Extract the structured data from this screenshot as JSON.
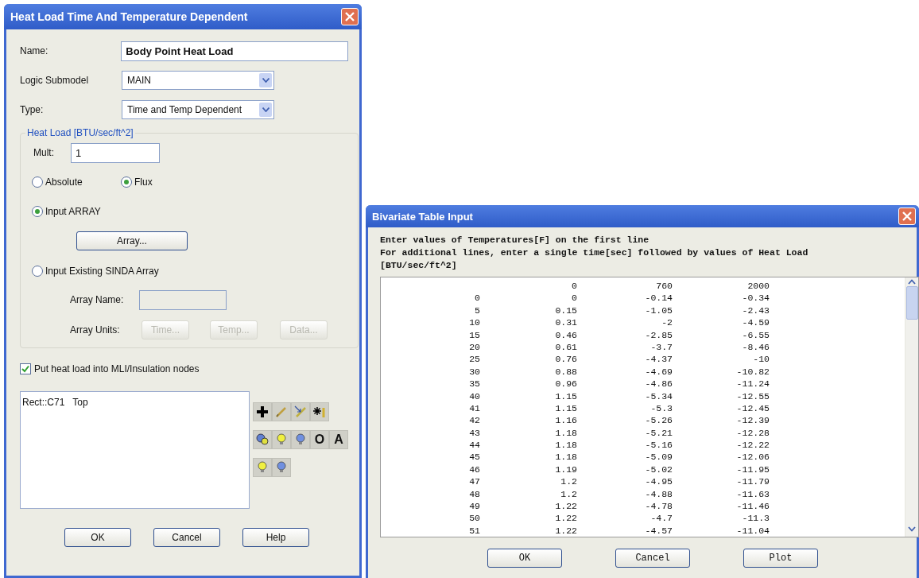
{
  "heat_load_dialog": {
    "title": "Heat Load Time And Temperature Dependent",
    "name": {
      "label": "Name:",
      "value": "Body Point Heat Load"
    },
    "logic_submodel": {
      "label": "Logic Submodel",
      "value": "MAIN"
    },
    "type": {
      "label": "Type:",
      "value": "Time and Temp Dependent"
    },
    "heat_load_group": {
      "title": "Heat Load [BTU/sec/ft^2]",
      "mult": {
        "label": "Mult:",
        "value": "1"
      },
      "mode_options": [
        {
          "label": "Absolute",
          "selected": false
        },
        {
          "label": "Flux",
          "selected": true
        }
      ],
      "source_options": [
        {
          "label": "Input ARRAY",
          "selected": true
        },
        {
          "label": "Input Existing SINDA Array",
          "selected": false
        }
      ],
      "array_button": "Array...",
      "array_name": {
        "label": "Array Name:",
        "disabled": true
      },
      "array_units": {
        "label": "Array Units:",
        "disabled": true,
        "buttons": [
          "Time...",
          "Temp...",
          "Data..."
        ]
      }
    },
    "mli_checkbox": {
      "label": "Put heat load into MLI/Insulation nodes",
      "checked": true
    },
    "surfaces": [
      {
        "name": "Rect::C71",
        "side": "Top"
      }
    ],
    "letter_tools": [
      "O",
      "A"
    ],
    "buttons": [
      "OK",
      "Cancel",
      "Help"
    ]
  },
  "bivariate_dialog": {
    "title": "Bivariate Table Input",
    "instructions": [
      "Enter values of Temperatures[F] on the first line",
      "For additional lines, enter a single time[sec] followed by values of Heat Load [BTU/sec/ft^2]"
    ],
    "table": {
      "temperatures": [
        "0",
        "760",
        "2000"
      ],
      "rows": [
        [
          "0",
          "0",
          "-0.14",
          "-0.34"
        ],
        [
          "5",
          "0.15",
          "-1.05",
          "-2.43"
        ],
        [
          "10",
          "0.31",
          "-2",
          "-4.59"
        ],
        [
          "15",
          "0.46",
          "-2.85",
          "-6.55"
        ],
        [
          "20",
          "0.61",
          "-3.7",
          "-8.46"
        ],
        [
          "25",
          "0.76",
          "-4.37",
          "-10"
        ],
        [
          "30",
          "0.88",
          "-4.69",
          "-10.82"
        ],
        [
          "35",
          "0.96",
          "-4.86",
          "-11.24"
        ],
        [
          "40",
          "1.15",
          "-5.34",
          "-12.55"
        ],
        [
          "41",
          "1.15",
          "-5.3",
          "-12.45"
        ],
        [
          "42",
          "1.16",
          "-5.26",
          "-12.39"
        ],
        [
          "43",
          "1.18",
          "-5.21",
          "-12.28"
        ],
        [
          "44",
          "1.18",
          "-5.16",
          "-12.22"
        ],
        [
          "45",
          "1.18",
          "-5.09",
          "-12.06"
        ],
        [
          "46",
          "1.19",
          "-5.02",
          "-11.95"
        ],
        [
          "47",
          "1.2",
          "-4.95",
          "-11.79"
        ],
        [
          "48",
          "1.2",
          "-4.88",
          "-11.63"
        ],
        [
          "49",
          "1.22",
          "-4.78",
          "-11.46"
        ],
        [
          "50",
          "1.22",
          "-4.7",
          "-11.3"
        ],
        [
          "51",
          "1.22",
          "-4.57",
          "-11.04"
        ]
      ]
    },
    "buttons": [
      "OK",
      "Cancel",
      "Plot"
    ]
  }
}
